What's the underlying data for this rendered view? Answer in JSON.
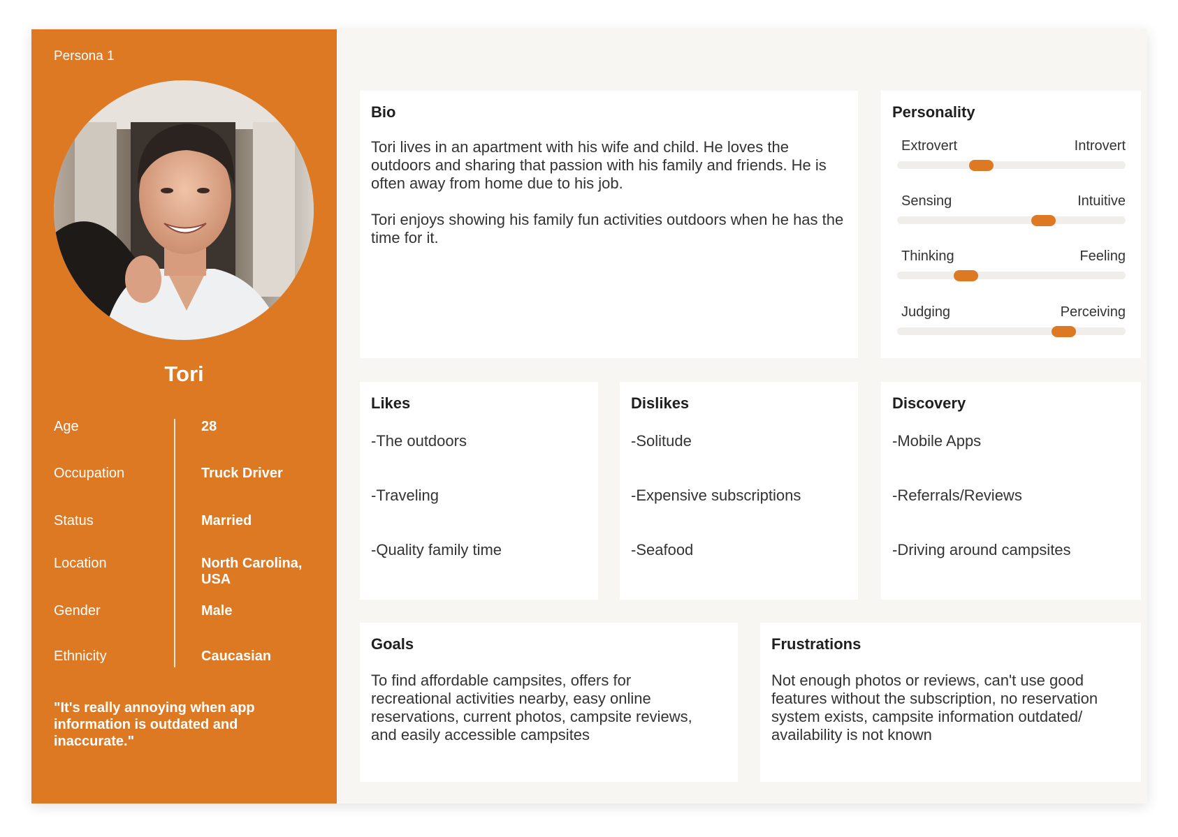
{
  "persona": {
    "label": "Persona 1",
    "name": "Tori",
    "attributes": [
      {
        "label": "Age",
        "value": "28"
      },
      {
        "label": "Occupation",
        "value": "Truck Driver"
      },
      {
        "label": "Status",
        "value": "Married"
      },
      {
        "label": "Location",
        "value": "North Carolina, USA"
      },
      {
        "label": "Gender",
        "value": "Male"
      },
      {
        "label": "Ethnicity",
        "value": "Caucasian"
      }
    ],
    "quote": "\"It's really annoying when app information is outdated and inaccurate.\""
  },
  "bio": {
    "title": "Bio",
    "paragraphs": [
      "Tori lives in an apartment with his wife and child. He loves the outdoors and sharing that passion with his family and friends. He is often away from home due to his job.",
      "Tori enjoys showing his family fun activities outdoors when he has the time for it."
    ]
  },
  "personality": {
    "title": "Personality",
    "traits": [
      {
        "left": "Extrovert",
        "right": "Introvert",
        "level": 0.37
      },
      {
        "left": "Sensing",
        "right": "Intuitive",
        "level": 0.64
      },
      {
        "left": "Thinking",
        "right": "Feeling",
        "level": 0.3
      },
      {
        "left": "Judging",
        "right": "Perceiving",
        "level": 0.73
      }
    ]
  },
  "likes": {
    "title": "Likes",
    "items": [
      "-The outdoors",
      "-Traveling",
      "-Quality family time"
    ]
  },
  "dislikes": {
    "title": "Dislikes",
    "items": [
      "-Solitude",
      "-Expensive subscriptions",
      "-Seafood"
    ]
  },
  "discovery": {
    "title": "Discovery",
    "items": [
      "-Mobile Apps",
      "-Referrals/Reviews",
      "-Driving around campsites"
    ]
  },
  "goals": {
    "title": "Goals",
    "text": "To find affordable campsites, offers for recreational activities nearby, easy online reservations, current photos, campsite reviews, and easily accessible campsites"
  },
  "frustrations": {
    "title": "Frustrations",
    "text": "Not enough photos or reviews, can't use good features without the subscription, no reservation system exists, campsite information outdated/ availability is not known"
  },
  "colors": {
    "accent": "#dd7823",
    "background": "#f7f6f3",
    "panel": "#ffffff",
    "track": "#efeeea"
  }
}
